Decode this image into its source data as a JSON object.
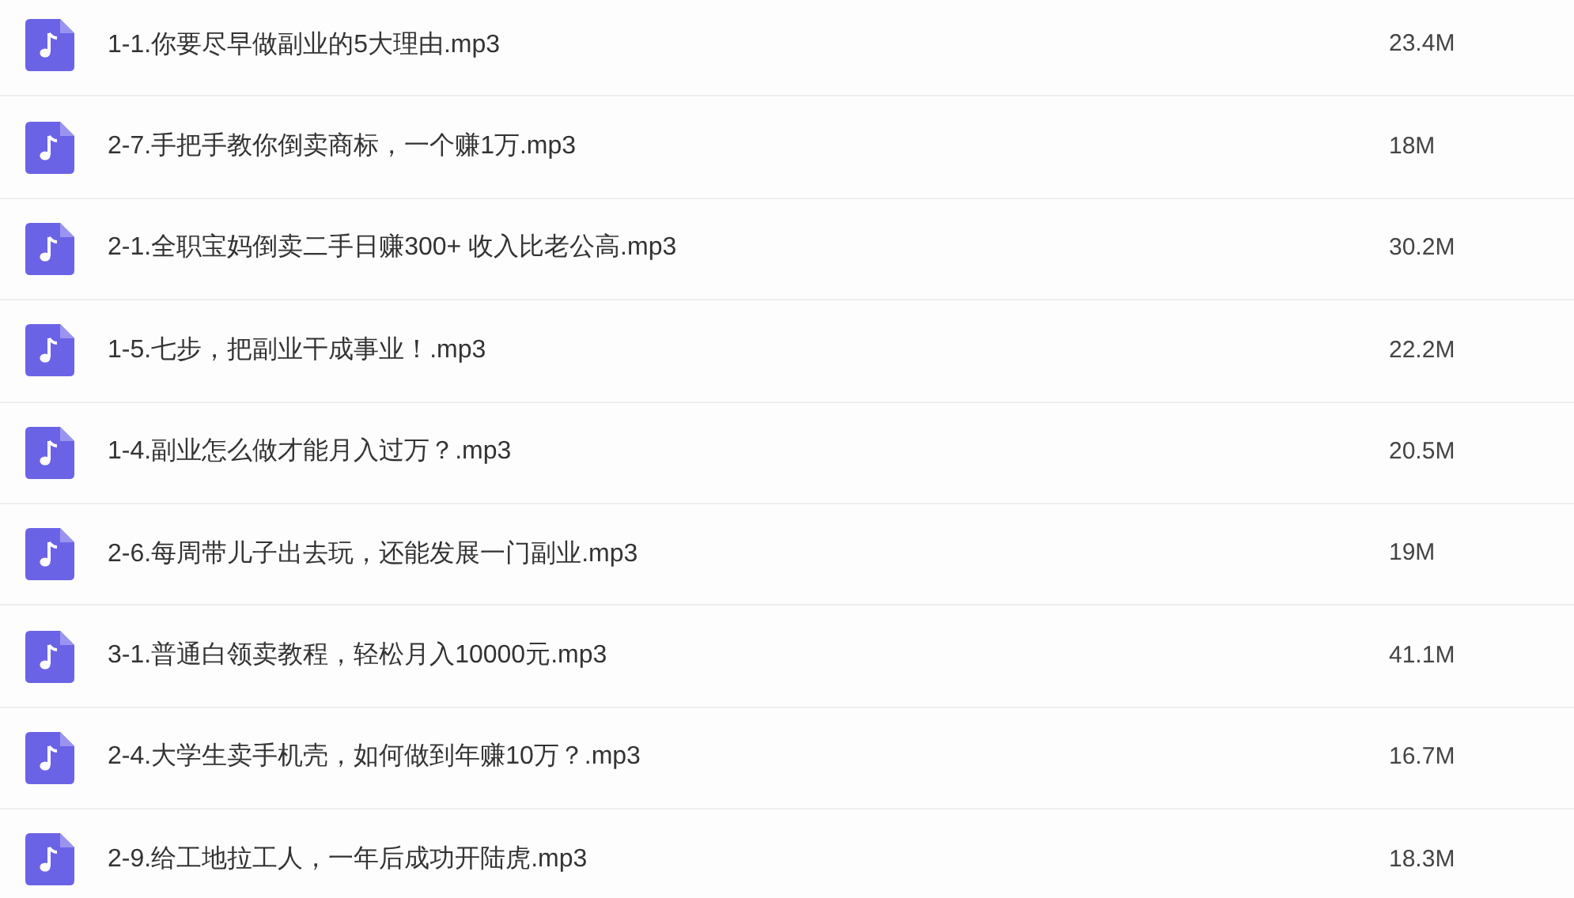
{
  "files": [
    {
      "name": "1-1.你要尽早做副业的5大理由.mp3",
      "size": "23.4M"
    },
    {
      "name": "2-7.手把手教你倒卖商标，一个赚1万.mp3",
      "size": "18M"
    },
    {
      "name": "2-1.全职宝妈倒卖二手日赚300+ 收入比老公高.mp3",
      "size": "30.2M"
    },
    {
      "name": "1-5.七步，把副业干成事业！.mp3",
      "size": "22.2M"
    },
    {
      "name": "1-4.副业怎么做才能月入过万？.mp3",
      "size": "20.5M"
    },
    {
      "name": "2-6.每周带儿子出去玩，还能发展一门副业.mp3",
      "size": "19M"
    },
    {
      "name": "3-1.普通白领卖教程，轻松月入10000元.mp3",
      "size": "41.1M"
    },
    {
      "name": "2-4.大学生卖手机壳，如何做到年赚10万？.mp3",
      "size": "16.7M"
    },
    {
      "name": "2-9.给工地拉工人，一年后成功开陆虎.mp3",
      "size": "18.3M"
    }
  ]
}
